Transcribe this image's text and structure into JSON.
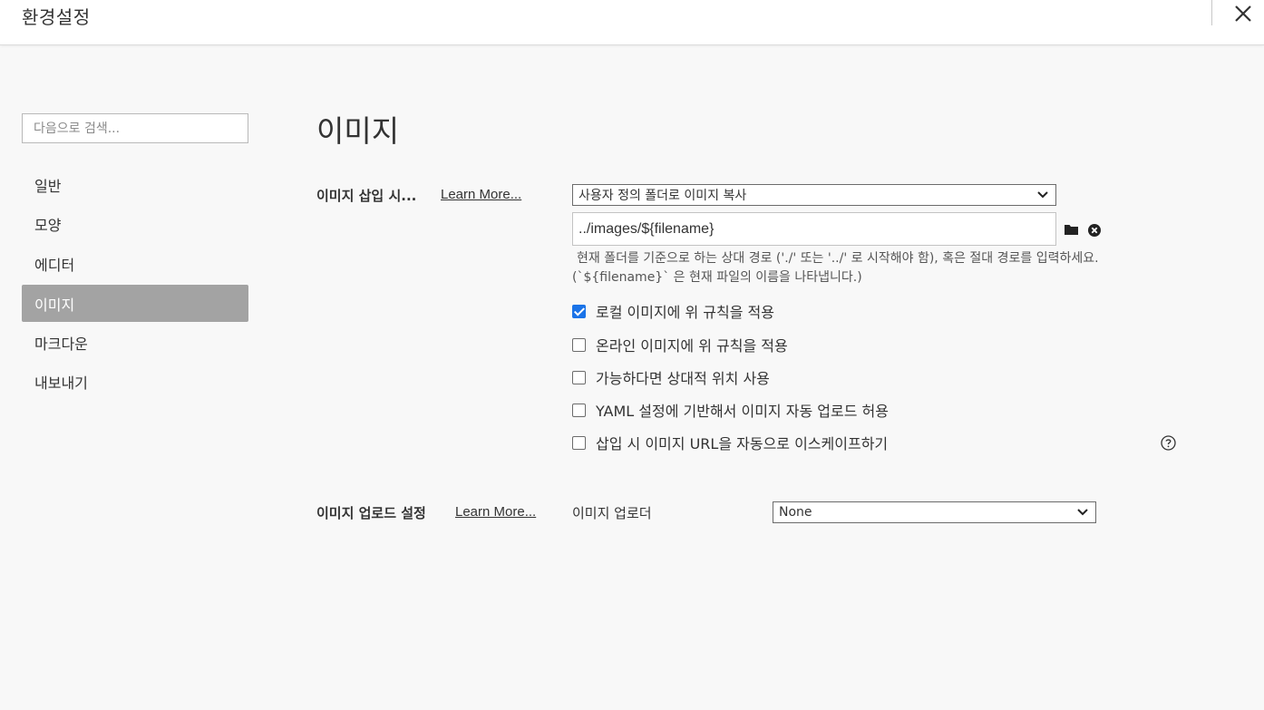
{
  "window": {
    "title": "환경설정"
  },
  "sidebar": {
    "search_placeholder": "다음으로 검색...",
    "items": [
      {
        "label": "일반",
        "active": false
      },
      {
        "label": "모양",
        "active": false
      },
      {
        "label": "에디터",
        "active": false
      },
      {
        "label": "이미지",
        "active": true
      },
      {
        "label": "마크다운",
        "active": false
      },
      {
        "label": "내보내기",
        "active": false
      }
    ]
  },
  "main": {
    "title": "이미지",
    "insert_section": {
      "label": "이미지 삽입 시...",
      "learn_more": "Learn More...",
      "action_select": "사용자 정의 폴더로 이미지 복사",
      "path_value": "../images/${filename}",
      "help_line1": "현재 폴더를 기준으로 하는 상대 경로 ('./' 또는 '../' 로 시작해야 함), 혹은 절대 경로를 입력하세요.",
      "help_line2": "(`${filename}` 은 현재 파일의 이름을 나타냅니다.)",
      "options": [
        {
          "label": "로컬 이미지에 위 규칙을 적용",
          "checked": true
        },
        {
          "label": "온라인 이미지에 위 규칙을 적용",
          "checked": false
        },
        {
          "label": "가능하다면 상대적 위치 사용",
          "checked": false
        },
        {
          "label": "YAML 설정에 기반해서 이미지 자동 업로드 허용",
          "checked": false
        },
        {
          "label": "삽입 시 이미지 URL을 자동으로 이스케이프하기",
          "checked": false
        }
      ]
    },
    "upload_section": {
      "label": "이미지 업로드 설정",
      "learn_more": "Learn More...",
      "uploader_label": "이미지 업로더",
      "uploader_value": "None"
    }
  },
  "icons": {
    "close": "close-icon",
    "folder": "folder-icon",
    "clear": "clear-icon",
    "help": "help-icon",
    "chevron": "chevron-down-icon"
  },
  "colors": {
    "accent": "#1a73e8",
    "active_nav": "#a3a3a3"
  }
}
